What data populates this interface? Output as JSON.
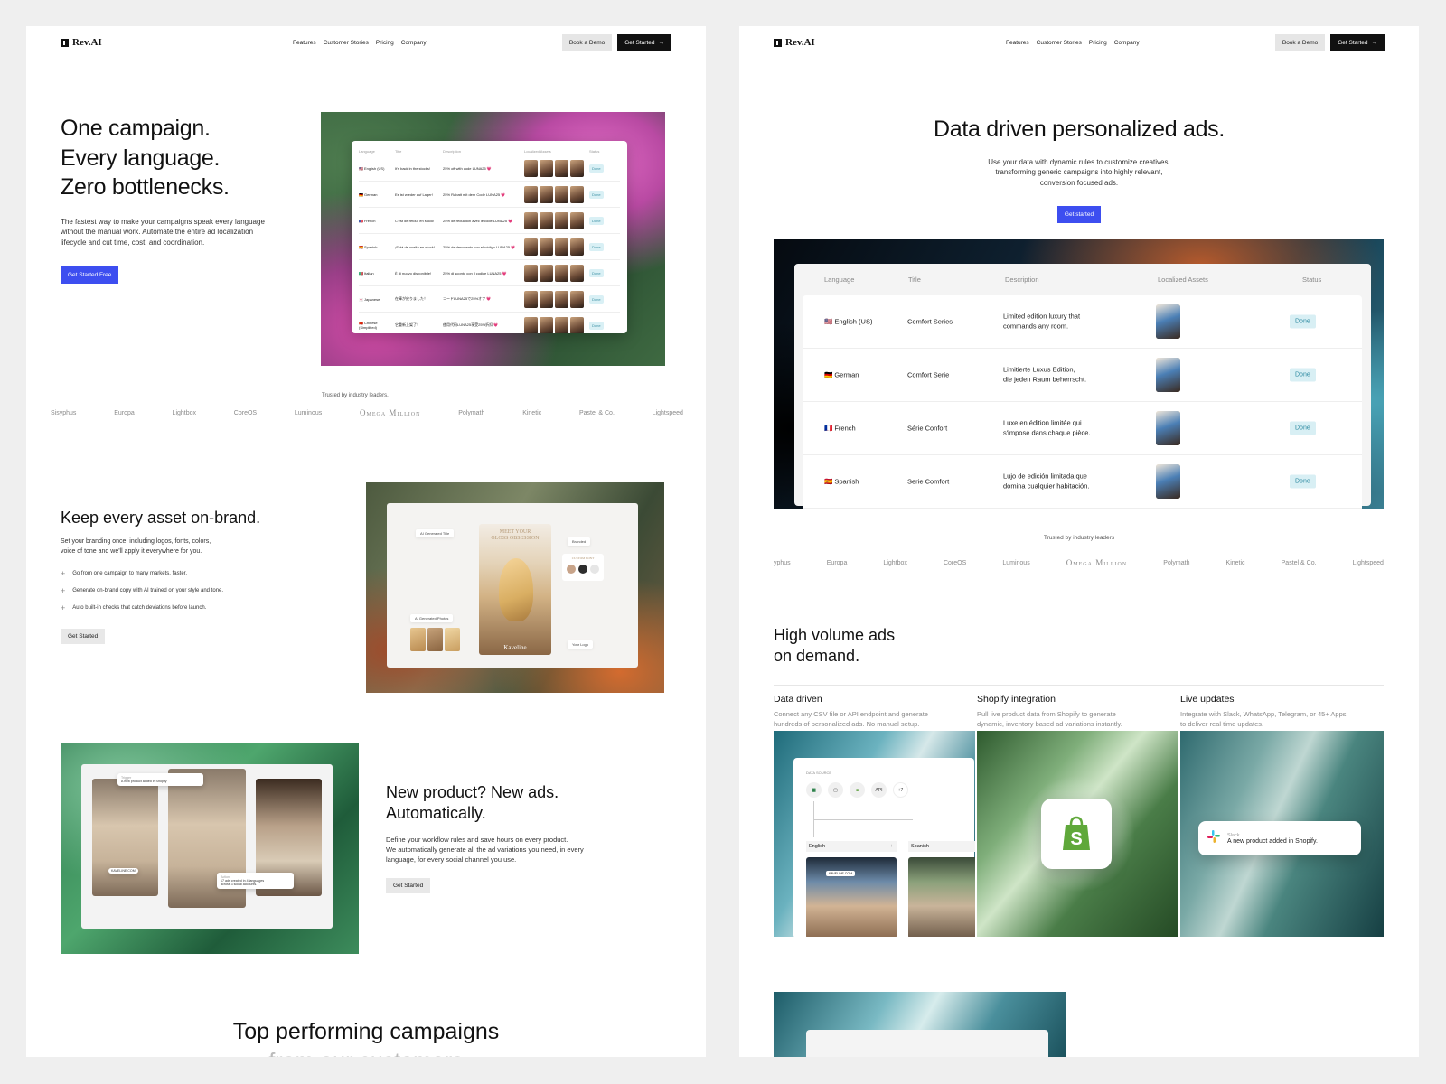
{
  "nav": {
    "logo": "Rev.AI",
    "links": [
      "Features",
      "Customer Stories",
      "Pricing",
      "Company"
    ],
    "book_demo": "Book a Demo",
    "get_started": "Get Started",
    "arrow": "→"
  },
  "left": {
    "hero": {
      "title_lines": [
        "One campaign.",
        "Every language.",
        "Zero bottlenecks."
      ],
      "desc_lines": [
        "The fastest way to make your campaigns speak every language",
        "without the manual work. Automate the entire ad localization",
        "lifecycle and cut time, cost, and coordination."
      ],
      "cta": "Get Started Free"
    },
    "table": {
      "headers": [
        "Language",
        "Title",
        "Description",
        "Localized Assets",
        "Status"
      ],
      "rows": [
        {
          "flag": "🇺🇸",
          "lang": "English (US)",
          "title": "It's back in the stocks!",
          "desc": "25% off with code LUNA25 💗",
          "status": "Done"
        },
        {
          "flag": "🇩🇪",
          "lang": "German",
          "title": "Es ist wieder auf Lager!",
          "desc": "25% Rabatt mit dem Code LUNA25 💗",
          "status": "Done"
        },
        {
          "flag": "🇫🇷",
          "lang": "French",
          "title": "C'est de retour en stock!",
          "desc": "25% de réduction avec le code LUNA25 💗",
          "status": "Done"
        },
        {
          "flag": "🇪🇸",
          "lang": "Spanish",
          "title": "¡Está de vuelta en stock!",
          "desc": "25% de descuento con el código LUNA25 💗",
          "status": "Done"
        },
        {
          "flag": "🇮🇹",
          "lang": "Italian",
          "title": "È di nuovo disponibile!",
          "desc": "25% di sconto con il codice LUNA25 💗",
          "status": "Done"
        },
        {
          "flag": "🇯🇵",
          "lang": "Japanese",
          "title": "在庫が戻りました！",
          "desc": "コードLUNA25で25%オフ 💗",
          "status": "Done"
        },
        {
          "flag": "🇨🇳",
          "lang": "Chinese (Simplified)",
          "title": "它重新上架了！",
          "desc": "使用代码LUNA25享受25%折扣 💗",
          "status": "Done"
        }
      ]
    },
    "trusted": "Trusted by industry leaders.",
    "logos": [
      "Sisyphus",
      "Europa",
      "Lightbox",
      "CoreOS",
      "Luminous",
      "Omega Million",
      "Polymath",
      "Kinetic",
      "Pastel & Co.",
      "Lightspeed"
    ],
    "brand": {
      "title": "Keep every asset on-brand.",
      "desc_lines": [
        "Set your branding once, including logos, fonts, colors,",
        "voice of tone and we'll apply it everywhere for you."
      ],
      "checks": [
        "Go from one campaign to many markets, faster.",
        "Generate on-brand copy with AI trained on your style and tone.",
        "Auto built-in checks that catch deviations before launch."
      ],
      "cta": "Get Started",
      "card": {
        "ai_title": "AI Generated Title",
        "headline_lines": [
          "MEET YOUR",
          "GLOSS OBSESSION"
        ],
        "branded": "Branded",
        "custom_font": "CUSTOM FONT",
        "ai_photos": "AI Generated Photos",
        "your_logo": "Your Logo",
        "brand_name": "Kaveline"
      },
      "swatches": [
        "#c8a48a",
        "#2e2e2e",
        "#e6e6e6"
      ]
    },
    "product": {
      "title_lines": [
        "New product? New ads.",
        "Automatically."
      ],
      "desc_lines": [
        "Define your workflow rules and save hours on every product.",
        "We automatically generate all the ad variations you need, in every",
        "language, for every social channel you use."
      ],
      "cta": "Get Started",
      "toast1_app": "Trigger",
      "toast1_msg": "A new product added in Shopify",
      "toast2_app": "Action",
      "toast2_msg_lines": [
        "17 ads created in 4 languages",
        "across 3 social accounts."
      ],
      "tag": "KAVELINE.COM"
    },
    "top_title_lines": [
      "Top performing campaigns",
      "from our customers"
    ]
  },
  "right": {
    "hero": {
      "title": "Data driven personalized ads.",
      "desc_lines": [
        "Use your data with dynamic rules to customize creatives,",
        "transforming generic campaigns into highly relevant,",
        "conversion focused ads."
      ],
      "cta": "Get started"
    },
    "table": {
      "headers": [
        "Language",
        "Title",
        "Description",
        "Localized Assets",
        "Status"
      ],
      "rows": [
        {
          "flag": "🇺🇸",
          "lang": "English (US)",
          "title": "Comfort Series",
          "desc_lines": [
            "Limited edition luxury that",
            "commands any room."
          ],
          "status": "Done"
        },
        {
          "flag": "🇩🇪",
          "lang": "German",
          "title": "Comfort Serie",
          "desc_lines": [
            "Limitierte Luxus Edition,",
            "die jeden Raum beherrscht."
          ],
          "status": "Done"
        },
        {
          "flag": "🇫🇷",
          "lang": "French",
          "title": "Série Confort",
          "desc_lines": [
            "Luxe en édition limitée qui",
            "s'impose dans chaque pièce."
          ],
          "status": "Done"
        },
        {
          "flag": "🇪🇸",
          "lang": "Spanish",
          "title": "Serie Comfort",
          "desc_lines": [
            "Lujo de edición limitada que",
            "domina cualquier habitación."
          ],
          "status": "Done"
        }
      ],
      "asset_colors": [
        "#b98a62",
        "#c2473e",
        "#8fae63",
        "#4b7fb5"
      ]
    },
    "trusted": "Trusted by industry leaders",
    "logos": [
      "yphus",
      "Europa",
      "Lightbox",
      "CoreOS",
      "Luminous",
      "Omega Million",
      "Polymath",
      "Kinetic",
      "Pastel & Co.",
      "Lightspeed"
    ],
    "volume_title_lines": [
      "High volume ads",
      "on demand."
    ],
    "features": [
      {
        "title": "Data driven",
        "desc_lines": [
          "Connect any CSV file or API endpoint and generate",
          "hundreds of personalized ads. No manual setup."
        ]
      },
      {
        "title": "Shopify integration",
        "desc_lines": [
          "Pull live product data from Shopify to generate",
          "dynamic, inventory based ad variations instantly."
        ]
      },
      {
        "title": "Live updates",
        "desc_lines": [
          "Integrate with Slack, WhatsApp, Telegram, or 45+ Apps",
          "to deliver real time updates."
        ]
      }
    ],
    "datasource": {
      "label": "DATA SOURCE",
      "api": "API",
      "more": "+7",
      "col1": "English",
      "col2": "Spanish",
      "tag": "KAVELINE.COM"
    },
    "slack": {
      "app": "Slack",
      "msg": "A new product added in Shopify."
    }
  }
}
